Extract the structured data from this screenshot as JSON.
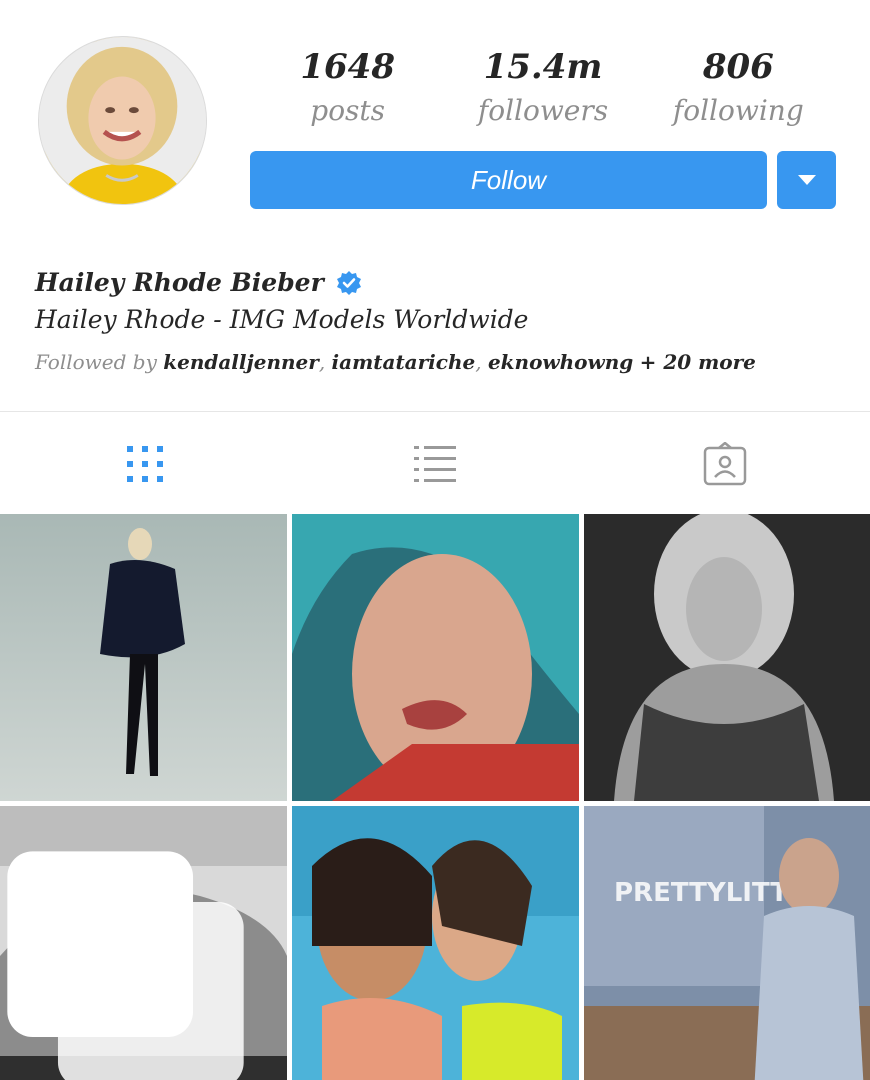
{
  "profile": {
    "name": "Hailey Rhode Bieber",
    "bio": "Hailey Rhode - IMG Models Worldwide",
    "followed_by_prefix": "Followed by",
    "followed_by_users": [
      "kendalljenner",
      "iamtatariche",
      "eknowhowng"
    ],
    "followed_by_more": "+ 20 more",
    "verified_icon": "verified-badge-icon"
  },
  "stats": {
    "posts": {
      "value": "1648",
      "label": "posts"
    },
    "followers": {
      "value": "15.4m",
      "label": "followers"
    },
    "following": {
      "value": "806",
      "label": "following"
    }
  },
  "actions": {
    "follow_label": "Follow",
    "dropdown_icon": "caret-down-icon"
  },
  "tabs": [
    {
      "name": "grid-view",
      "icon": "grid-icon",
      "active": true
    },
    {
      "name": "list-view",
      "icon": "list-icon",
      "active": false
    },
    {
      "name": "tagged",
      "icon": "tagged-person-icon",
      "active": false
    }
  ],
  "colors": {
    "accent": "#3897f0",
    "text": "#262626",
    "muted": "#8e8e8e",
    "verified": "#3897f0"
  },
  "posts_grid": [
    {
      "desc": "photo-post-1",
      "multi": false
    },
    {
      "desc": "photo-post-2",
      "multi": false
    },
    {
      "desc": "photo-post-3",
      "multi": false
    },
    {
      "desc": "photo-post-4",
      "multi": true
    },
    {
      "desc": "photo-post-5",
      "multi": false
    },
    {
      "desc": "photo-post-6",
      "multi": false
    }
  ],
  "post_overlay_text": "PRETTYLITTLE"
}
